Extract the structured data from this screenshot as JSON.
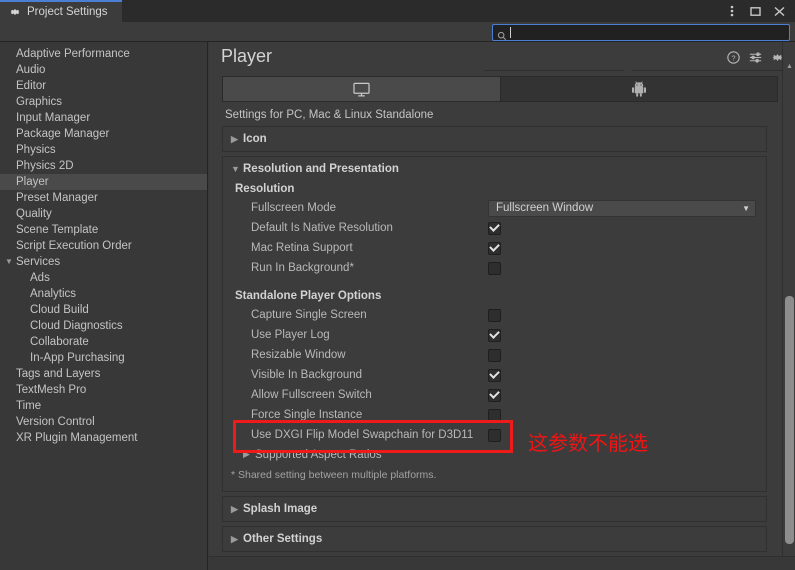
{
  "window": {
    "tab_label": "Project Settings",
    "tab_icon": "gear-icon",
    "controls": [
      {
        "name": "more-menu",
        "glyph": "⋮"
      },
      {
        "name": "maximize",
        "glyph": "☐"
      },
      {
        "name": "close",
        "glyph": "✕"
      }
    ]
  },
  "search": {
    "value": "",
    "placeholder": "",
    "icon": "search-icon"
  },
  "sidebar": {
    "items": [
      {
        "label": "Adaptive Performance",
        "level": 0,
        "selected": false,
        "expander": ""
      },
      {
        "label": "Audio",
        "level": 0,
        "selected": false,
        "expander": ""
      },
      {
        "label": "Editor",
        "level": 0,
        "selected": false,
        "expander": ""
      },
      {
        "label": "Graphics",
        "level": 0,
        "selected": false,
        "expander": ""
      },
      {
        "label": "Input Manager",
        "level": 0,
        "selected": false,
        "expander": ""
      },
      {
        "label": "Package Manager",
        "level": 0,
        "selected": false,
        "expander": ""
      },
      {
        "label": "Physics",
        "level": 0,
        "selected": false,
        "expander": ""
      },
      {
        "label": "Physics 2D",
        "level": 0,
        "selected": false,
        "expander": ""
      },
      {
        "label": "Player",
        "level": 0,
        "selected": true,
        "expander": ""
      },
      {
        "label": "Preset Manager",
        "level": 0,
        "selected": false,
        "expander": ""
      },
      {
        "label": "Quality",
        "level": 0,
        "selected": false,
        "expander": ""
      },
      {
        "label": "Scene Template",
        "level": 0,
        "selected": false,
        "expander": ""
      },
      {
        "label": "Script Execution Order",
        "level": 0,
        "selected": false,
        "expander": ""
      },
      {
        "label": "Services",
        "level": 0,
        "selected": false,
        "expander": "▼"
      },
      {
        "label": "Ads",
        "level": 1,
        "selected": false,
        "expander": ""
      },
      {
        "label": "Analytics",
        "level": 1,
        "selected": false,
        "expander": ""
      },
      {
        "label": "Cloud Build",
        "level": 1,
        "selected": false,
        "expander": ""
      },
      {
        "label": "Cloud Diagnostics",
        "level": 1,
        "selected": false,
        "expander": ""
      },
      {
        "label": "Collaborate",
        "level": 1,
        "selected": false,
        "expander": ""
      },
      {
        "label": "In-App Purchasing",
        "level": 1,
        "selected": false,
        "expander": ""
      },
      {
        "label": "Tags and Layers",
        "level": 0,
        "selected": false,
        "expander": ""
      },
      {
        "label": "TextMesh Pro",
        "level": 0,
        "selected": false,
        "expander": ""
      },
      {
        "label": "Time",
        "level": 0,
        "selected": false,
        "expander": ""
      },
      {
        "label": "Version Control",
        "level": 0,
        "selected": false,
        "expander": ""
      },
      {
        "label": "XR Plugin Management",
        "level": 0,
        "selected": false,
        "expander": ""
      }
    ]
  },
  "panel": {
    "title": "Player",
    "header_icons": [
      {
        "name": "help-icon"
      },
      {
        "name": "preset-icon"
      },
      {
        "name": "gear-icon"
      }
    ],
    "platform_tabs": [
      {
        "name": "standalone",
        "icon": "desktop-icon",
        "active": true
      },
      {
        "name": "android",
        "icon": "android-icon",
        "active": false
      }
    ],
    "settings_for": "Settings for PC, Mac & Linux Standalone",
    "sections": {
      "icon": {
        "title": "Icon",
        "expander": "▶",
        "expanded": false
      },
      "resolution": {
        "title": "Resolution and Presentation",
        "expander": "▼",
        "expanded": true,
        "group_resolution": "Resolution",
        "group_standalone": "Standalone Player Options",
        "fullscreen_mode": {
          "label": "Fullscreen Mode",
          "value": "Fullscreen Window",
          "arrow": "▼"
        },
        "checkboxes": [
          {
            "label": "Default Is Native Resolution",
            "checked": true
          },
          {
            "label": "Mac Retina Support",
            "checked": true
          },
          {
            "label": "Run In Background*",
            "checked": false
          }
        ],
        "standalone_checkboxes": [
          {
            "label": "Capture Single Screen",
            "checked": false
          },
          {
            "label": "Use Player Log",
            "checked": true
          },
          {
            "label": "Resizable Window",
            "checked": false
          },
          {
            "label": "Visible In Background",
            "checked": true
          },
          {
            "label": "Allow Fullscreen Switch",
            "checked": true
          },
          {
            "label": "Force Single Instance",
            "checked": false
          },
          {
            "label": "Use DXGI Flip Model Swapchain for D3D11",
            "checked": false
          }
        ],
        "aspect_ratios": {
          "label": "Supported Aspect Ratios",
          "expander": "▶"
        },
        "footnote": "* Shared setting between multiple platforms."
      },
      "splash": {
        "title": "Splash Image",
        "expander": "▶",
        "expanded": false
      },
      "other": {
        "title": "Other Settings",
        "expander": "▶",
        "expanded": false
      }
    }
  },
  "annotation": {
    "text": "这参数不能选",
    "color": "#ef1b1b",
    "highlights_field": "Use DXGI Flip Model Swapchain for D3D11"
  },
  "scrollbar": {
    "up_arrow": "▲",
    "down_arrow": "▼"
  },
  "colors": {
    "window_bg": "#383838",
    "panel_bg": "#3c3c3c",
    "titlebar_bg": "#2b2b2b",
    "accent_blue": "#4b7fd4",
    "selected_row": "#4a4a4a",
    "annotation_red": "#ef1b1b"
  }
}
